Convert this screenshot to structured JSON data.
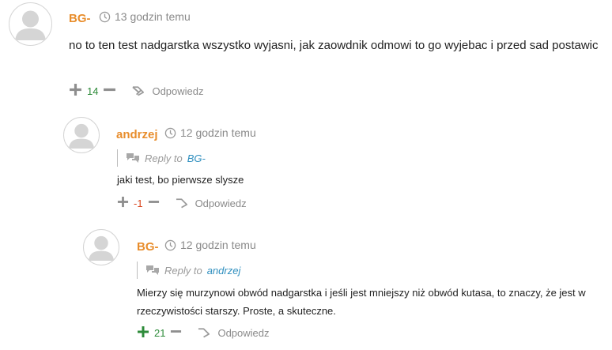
{
  "comments": [
    {
      "author": "BG-",
      "time": "13 godzin temu",
      "body": "no to ten test nadgarstka wszystko wyjasni, jak zaowdnik odmowi to go wyjebac i przed sad postawic",
      "score": "14",
      "reply_label": "Odpowiedz"
    },
    {
      "author": "andrzej",
      "time": "12 godzin temu",
      "reply_to_label": "Reply to",
      "reply_to_target": "BG-",
      "body": "jaki test, bo pierwsze slysze",
      "score": "-1",
      "reply_label": "Odpowiedz"
    },
    {
      "author": "BG-",
      "time": "12 godzin temu",
      "reply_to_label": "Reply to",
      "reply_to_target": "andrzej",
      "body": "Mierzy się murzynowi obwód nadgarstka i jeśli jest mniejszy niż obwód kutasa, to znaczy, że jest w rzeczywistości starszy. Proste, a skuteczne.",
      "score": "21",
      "reply_label": "Odpowiedz"
    }
  ],
  "colors": {
    "author": "#e88d2c",
    "meta": "#8a8a8a",
    "link": "#2f8fbf",
    "positive": "#2e8b3a",
    "negative": "#d9441c"
  },
  "icons": [
    "avatar-placeholder",
    "clock-icon",
    "reply-arrow-icon",
    "plus-icon",
    "minus-icon",
    "comment-bubbles-icon"
  ]
}
